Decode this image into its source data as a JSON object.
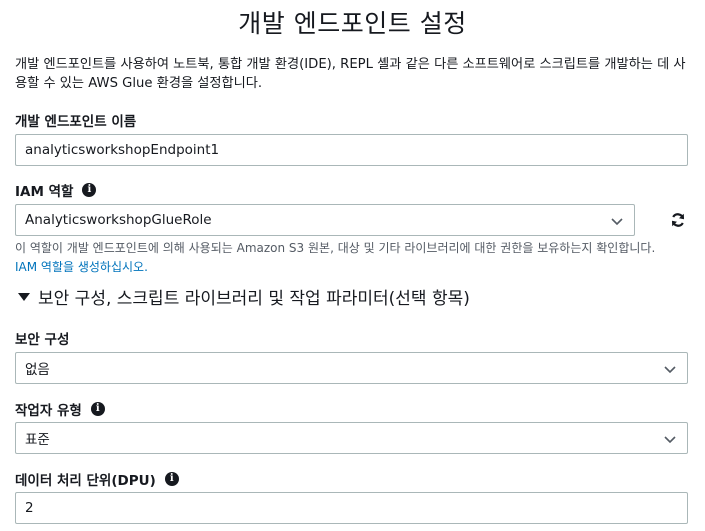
{
  "page": {
    "title": "개발 엔드포인트 설정",
    "description": "개발 엔드포인트를 사용하여 노트북, 통합 개발 환경(IDE), REPL 셸과 같은 다른 소프트웨어로 스크립트를 개발하는 데 사용할 수 있는 AWS Glue 환경을 설정합니다."
  },
  "endpoint_name": {
    "label": "개발 엔드포인트 이름",
    "value": "analyticsworkshopEndpoint1"
  },
  "iam_role": {
    "label": "IAM 역할",
    "value": "AnalyticsworkshopGlueRole",
    "hint": "이 역할이 개발 엔드포인트에 의해 사용되는 Amazon S3 원본, 대상 및 기타 라이브러리에 대한 권한을 보유하는지 확인합니다.",
    "link": "IAM 역할을 생성하십시오."
  },
  "section": {
    "title": "보안 구성, 스크립트 라이브러리 및 작업 파라미터(선택 항목)"
  },
  "security_config": {
    "label": "보안 구성",
    "value": "없음"
  },
  "worker_type": {
    "label": "작업자 유형",
    "value": "표준"
  },
  "dpu": {
    "label": "데이터 처리 단위(DPU)",
    "value": "2"
  },
  "icons": {
    "info": "info-icon",
    "chevron": "chevron-down-icon",
    "refresh": "refresh-icon",
    "caret": "caret-down-icon"
  },
  "colors": {
    "link": "#0073bb",
    "border": "#aab7b8",
    "hint_text": "#545b64"
  }
}
